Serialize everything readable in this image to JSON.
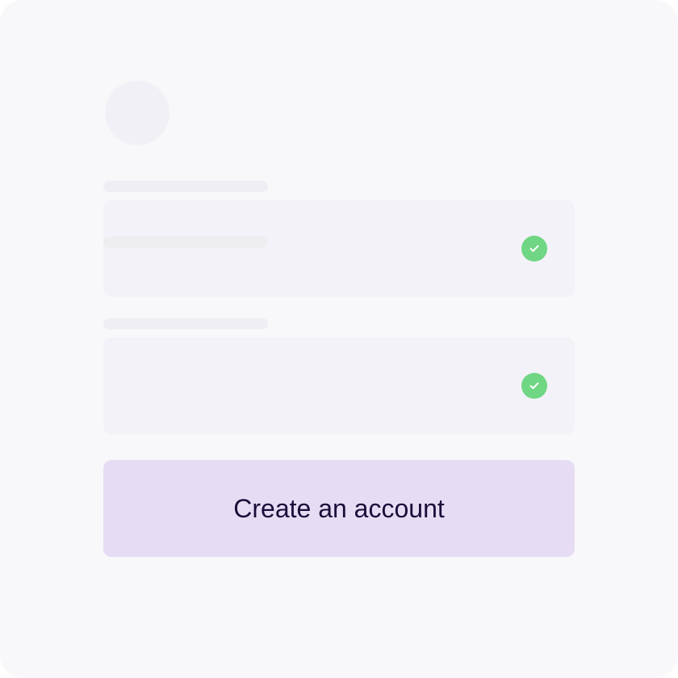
{
  "form": {
    "button_label": "Create an account",
    "fields": [
      {
        "status_icon": "check-circle-icon",
        "status": "valid"
      },
      {
        "status_icon": "check-circle-icon",
        "status": "valid"
      }
    ]
  },
  "colors": {
    "background": "#f8f8fa",
    "field_background": "#f3f2f8",
    "skeleton": "#efeef4",
    "success": "#6fd683",
    "button_background": "#e6ddf4",
    "button_text": "#1c0d3a"
  }
}
